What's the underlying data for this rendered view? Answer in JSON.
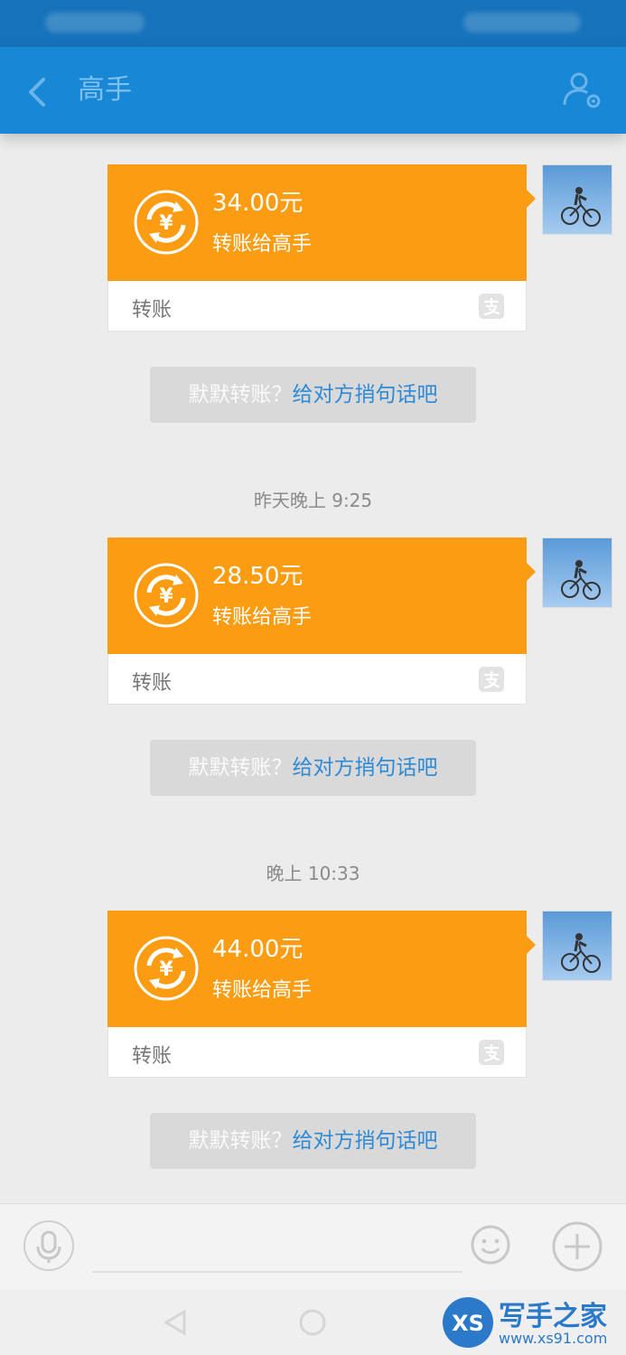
{
  "header": {
    "title": "高手"
  },
  "messages": [
    {
      "timestamp": "",
      "amount": "34.00元",
      "description": "转账给高手",
      "label": "转账"
    },
    {
      "timestamp": "昨天晚上 9:25",
      "amount": "28.50元",
      "description": "转账给高手",
      "label": "转账"
    },
    {
      "timestamp": "晚上 10:33",
      "amount": "44.00元",
      "description": "转账给高手",
      "label": "转账"
    }
  ],
  "hint": {
    "prefix": "默默转账？",
    "link": "给对方捎句话吧"
  },
  "icons": {
    "back": "chevron-left-icon",
    "profile": "person-settings-icon",
    "coin": "yuan-transfer-icon",
    "alipay": "alipay-icon",
    "mic": "microphone-icon",
    "emoji": "smiley-icon",
    "plus": "plus-icon"
  },
  "watermark": {
    "logo": "XS",
    "title": "写手之家",
    "url": "www.xs91.com"
  },
  "colors": {
    "header": "#1787d6",
    "card": "#fb9c12",
    "link": "#2f8ad6"
  }
}
